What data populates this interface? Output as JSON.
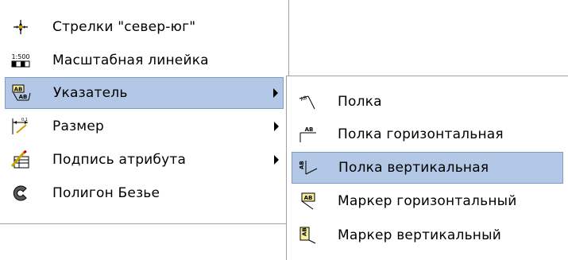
{
  "main_menu": {
    "items": [
      {
        "label": "Стрелки \"север-юг\"",
        "icon": "north-south-arrows-icon"
      },
      {
        "label": "Масштабная линейка",
        "icon": "scale-bar-icon",
        "icon_text": "1:500"
      },
      {
        "label": "Указатель",
        "icon": "leader-pointer-icon",
        "icon_text": "AB",
        "selected": true,
        "has_submenu": true
      },
      {
        "label": "Размер",
        "icon": "dimension-icon",
        "has_submenu": true
      },
      {
        "label": "Подпись атрибута",
        "icon": "attribute-label-icon",
        "has_submenu": true
      },
      {
        "label": "Полигон Безье",
        "icon": "bezier-polygon-icon"
      }
    ]
  },
  "sub_menu": {
    "items": [
      {
        "label": "Полка",
        "icon": "leader-shelf-icon"
      },
      {
        "label": "Полка горизонтальная",
        "icon": "horizontal-shelf-icon",
        "icon_text": "AB"
      },
      {
        "label": "Полка вертикальная",
        "icon": "vertical-shelf-icon",
        "selected": true
      },
      {
        "label": "Маркер горизонтальный",
        "icon": "horizontal-marker-icon",
        "icon_text": "AB"
      },
      {
        "label": "Маркер вертикальный",
        "icon": "vertical-marker-icon"
      }
    ]
  },
  "colors": {
    "selection_bg": "#b3c8e6",
    "selection_border": "#7f9cc8",
    "menu_border": "#a0a0a0"
  }
}
